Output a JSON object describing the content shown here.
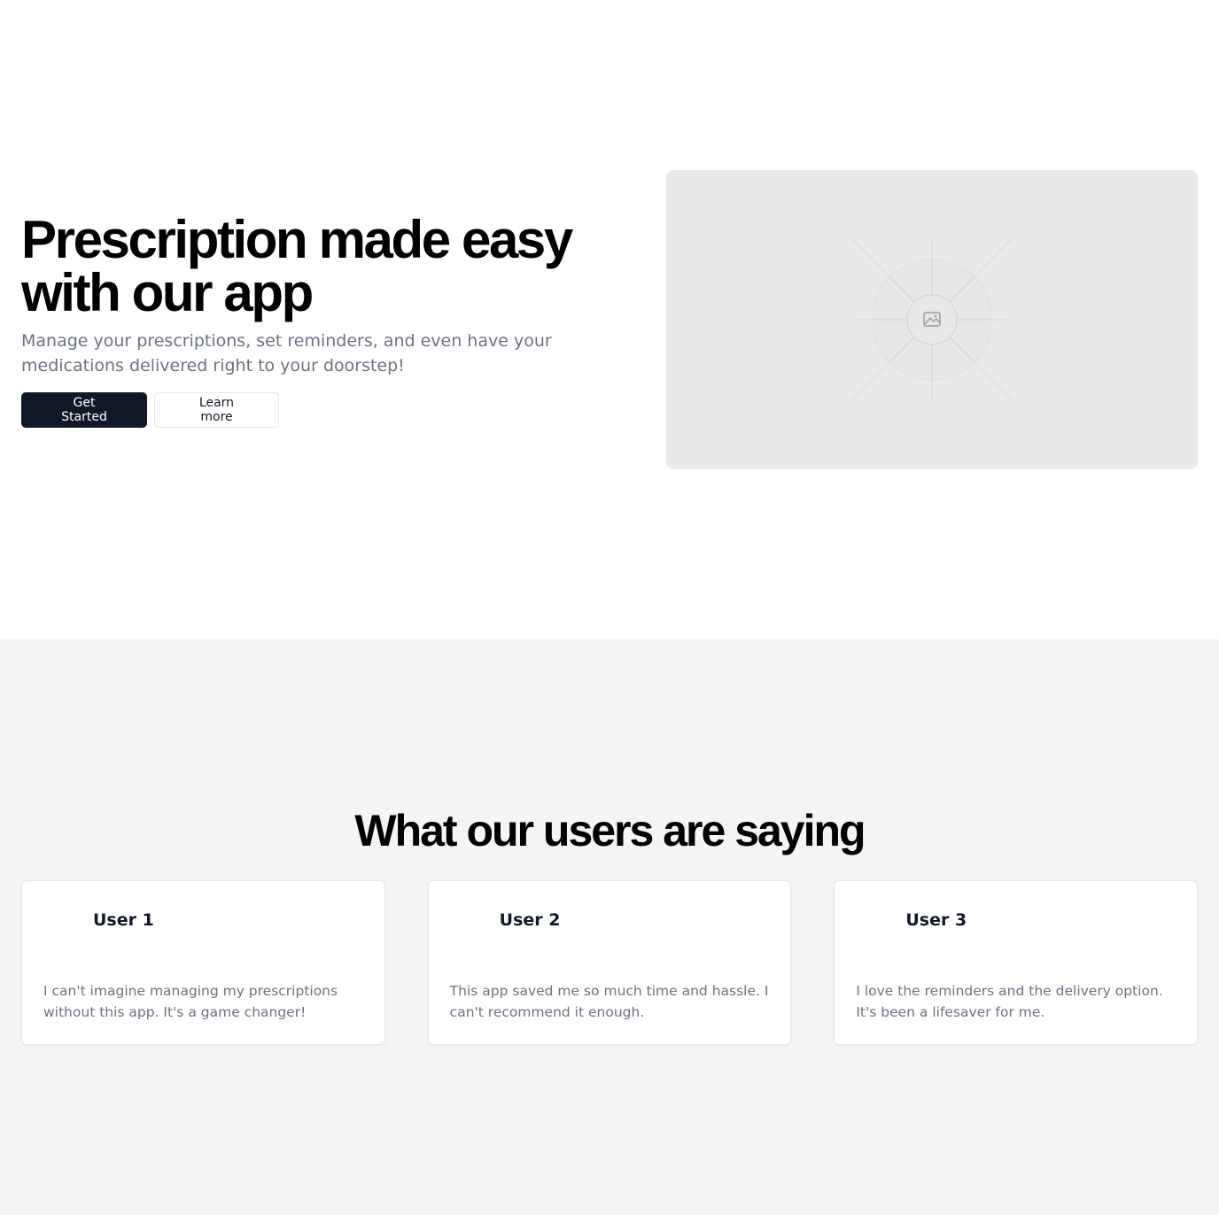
{
  "hero": {
    "title": "Prescription made easy with our app",
    "subtitle": "Manage your prescriptions, set reminders, and even have your medications delivered right to your doorstep!",
    "primary_button": "Get Started",
    "secondary_button": "Learn more",
    "image_icon": "image-placeholder-icon"
  },
  "testimonials": {
    "title": "What our users are saying",
    "items": [
      {
        "name": "User 1",
        "quote": "I can't imagine managing my prescriptions without this app. It's a game changer!"
      },
      {
        "name": "User 2",
        "quote": "This app saved me so much time and hassle. I can't recommend it enough."
      },
      {
        "name": "User 3",
        "quote": "I love the reminders and the delivery option. It's been a lifesaver for me."
      }
    ]
  },
  "colors": {
    "primary": "#111827",
    "muted_text": "#6b7280",
    "section_bg": "#f3f4f6",
    "placeholder_bg": "#e9e9e9"
  }
}
